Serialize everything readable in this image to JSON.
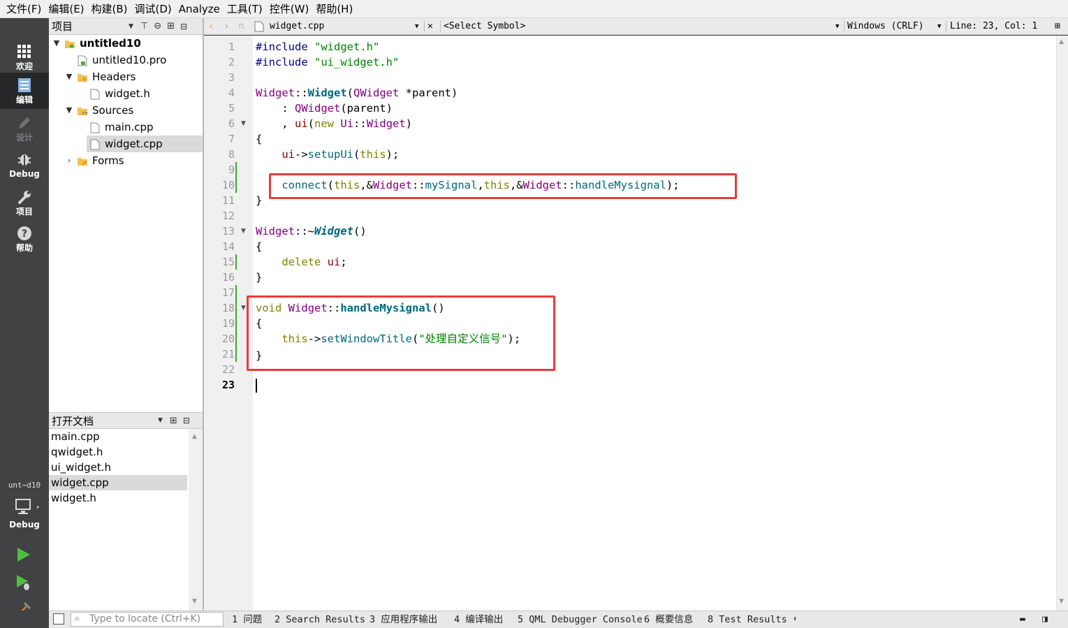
{
  "menu": [
    "文件(F)",
    "编辑(E)",
    "构建(B)",
    "调试(D)",
    "Analyze",
    "工具(T)",
    "控件(W)",
    "帮助(H)"
  ],
  "modes": {
    "welcome": "欢迎",
    "edit": "编辑",
    "design": "设计",
    "debug": "Debug",
    "projects": "项目",
    "help": "帮助"
  },
  "kit": {
    "project": "unt⋯d10",
    "build": "Debug"
  },
  "project_pane": {
    "title": "项目",
    "tree": [
      {
        "label": "untitled10",
        "bold": true
      },
      {
        "label": "untitled10.pro"
      },
      {
        "label": "Headers"
      },
      {
        "label": "widget.h"
      },
      {
        "label": "Sources"
      },
      {
        "label": "main.cpp"
      },
      {
        "label": "widget.cpp",
        "selected": true
      },
      {
        "label": "Forms"
      }
    ]
  },
  "open_documents": {
    "title": "打开文档",
    "items": [
      "main.cpp",
      "qwidget.h",
      "ui_widget.h",
      "widget.cpp",
      "widget.h"
    ],
    "selected": "widget.cpp"
  },
  "editor_toolbar": {
    "file": "widget.cpp",
    "symbol": "<Select Symbol>",
    "line_ending": "Windows (CRLF)",
    "position": "Line: 23, Col: 1"
  },
  "editor": {
    "line_numbers": [
      "1",
      "2",
      "3",
      "4",
      "5",
      "6",
      "7",
      "8",
      "9",
      "10",
      "11",
      "12",
      "13",
      "14",
      "15",
      "16",
      "17",
      "18",
      "19",
      "20",
      "21",
      "22",
      "23"
    ],
    "current_line": 23,
    "fold_lines": [
      6,
      13,
      18
    ],
    "changed_lines": [
      9,
      10,
      15,
      17,
      18,
      19,
      20,
      21
    ],
    "lines": {
      "l1a": "#include ",
      "l1b": "\"widget.h\"",
      "l2a": "#include ",
      "l2b": "\"ui_widget.h\"",
      "l4a": "Widget",
      "l4b": "::",
      "l4c": "Widget",
      "l4d": "(",
      "l4e": "QWidget",
      "l4f": " *parent)",
      "l5a": "    : ",
      "l5b": "QWidget",
      "l5c": "(parent)",
      "l6a": "    , ",
      "l6b": "ui",
      "l6c": "(",
      "l6d": "new",
      "l6e": " ",
      "l6f": "Ui",
      "l6g": "::",
      "l6h": "Widget",
      "l6i": ")",
      "l7": "{",
      "l8a": "    ",
      "l8b": "ui",
      "l8c": "->",
      "l8d": "setupUi",
      "l8e": "(",
      "l8f": "this",
      "l8g": ");",
      "l10a": "    ",
      "l10b": "connect",
      "l10c": "(",
      "l10d": "this",
      "l10e": ",&",
      "l10f": "Widget",
      "l10g": "::",
      "l10h": "mySignal",
      "l10i": ",",
      "l10j": "this",
      "l10k": ",&",
      "l10l": "Widget",
      "l10m": "::",
      "l10n": "handleMysignal",
      "l10o": ");",
      "l11": "}",
      "l13a": "Widget",
      "l13b": "::~",
      "l13c": "Widget",
      "l13d": "()",
      "l14": "{",
      "l15a": "    ",
      "l15b": "delete",
      "l15c": " ",
      "l15d": "ui",
      "l15e": ";",
      "l16": "}",
      "l18a": "void",
      "l18b": " ",
      "l18c": "Widget",
      "l18d": "::",
      "l18e": "handleMysignal",
      "l18f": "()",
      "l19": "{",
      "l20a": "    ",
      "l20b": "this",
      "l20c": "->",
      "l20d": "setWindowTitle",
      "l20e": "(",
      "l20f": "\"处理自定义信号\"",
      "l20g": ");",
      "l21": "}"
    }
  },
  "status_bar": {
    "locator_placeholder": "Type to locate (Ctrl+K)",
    "tabs": [
      "1 问题",
      "2 Search Results",
      "3 应用程序输出",
      "4 编译输出",
      "5 QML Debugger Console",
      "6 概要信息",
      "8 Test Results"
    ]
  },
  "colors": {
    "keyword": "#808000",
    "string": "#008000",
    "type": "#800080",
    "function": "#00677c",
    "highlight_box": "#e83c3c",
    "sidebar": "#404244"
  }
}
